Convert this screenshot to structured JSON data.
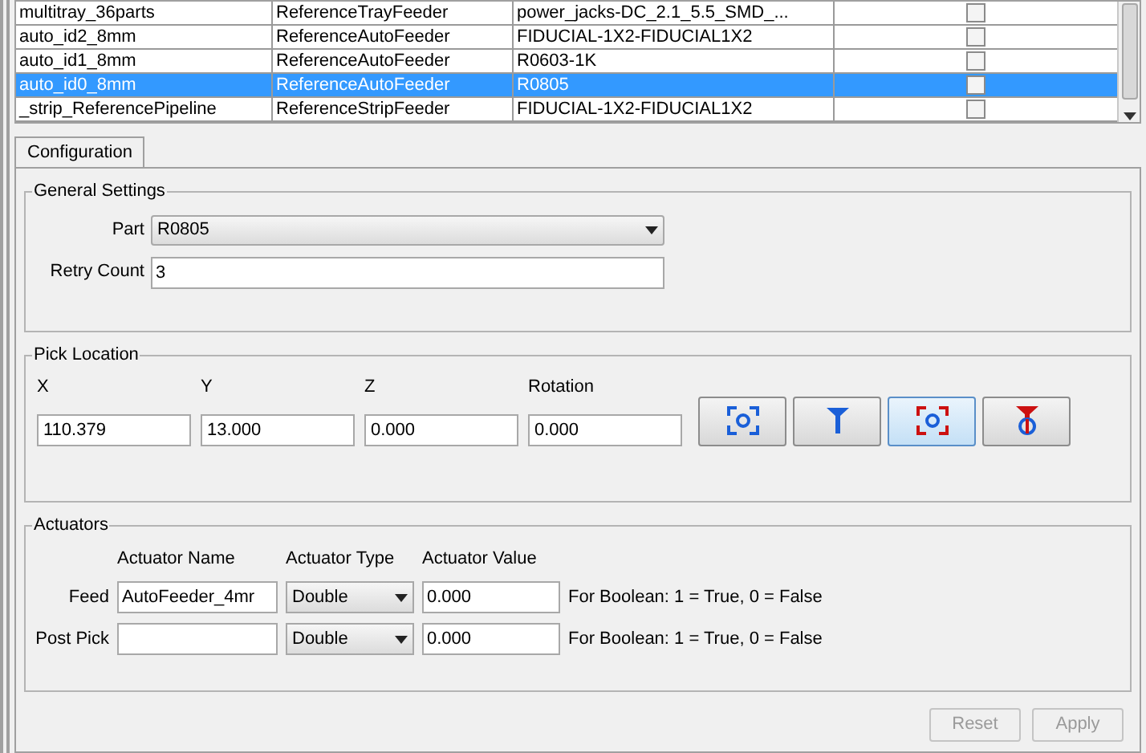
{
  "table": {
    "rows": [
      {
        "cells": [
          "multitray_36parts",
          "ReferenceTrayFeeder",
          "power_jacks-DC_2.1_5.5_SMD_..."
        ],
        "checked": false,
        "selected": false
      },
      {
        "cells": [
          "auto_id2_8mm",
          "ReferenceAutoFeeder",
          "FIDUCIAL-1X2-FIDUCIAL1X2"
        ],
        "checked": false,
        "selected": false
      },
      {
        "cells": [
          "auto_id1_8mm",
          "ReferenceAutoFeeder",
          "R0603-1K"
        ],
        "checked": false,
        "selected": false
      },
      {
        "cells": [
          "auto_id0_8mm",
          "ReferenceAutoFeeder",
          "R0805"
        ],
        "checked": false,
        "selected": true
      },
      {
        "cells": [
          "_strip_ReferencePipeline",
          "ReferenceStripFeeder",
          "FIDUCIAL-1X2-FIDUCIAL1X2"
        ],
        "checked": false,
        "selected": false
      }
    ]
  },
  "tabs": [
    {
      "label": "Configuration",
      "selected": true
    }
  ],
  "general_settings": {
    "title": "General Settings",
    "part": {
      "label": "Part",
      "value": "R0805"
    },
    "retry_count": {
      "label": "Retry Count",
      "value": "3"
    }
  },
  "pick_location": {
    "title": "Pick Location",
    "fields": [
      {
        "label": "X",
        "value": "110.379"
      },
      {
        "label": "Y",
        "value": "13.000"
      },
      {
        "label": "Z",
        "value": "0.000"
      },
      {
        "label": "Rotation",
        "value": "0.000"
      }
    ],
    "tool_buttons": [
      {
        "kind": "camera-capture",
        "selected": false
      },
      {
        "kind": "nozzle-capture",
        "selected": false
      },
      {
        "kind": "camera-position",
        "selected": true
      },
      {
        "kind": "nozzle-position",
        "selected": false
      }
    ]
  },
  "actuators": {
    "title": "Actuators",
    "columns": [
      "Actuator Name",
      "Actuator Type",
      "Actuator Value"
    ],
    "rows": [
      {
        "label": "Feed",
        "name": "AutoFeeder_4mr",
        "type": "Double",
        "value": "0.000",
        "hint": "For Boolean: 1 = True, 0 = False"
      },
      {
        "label": "Post Pick",
        "type": "Double",
        "value": "0.000",
        "hint": "For Boolean: 1 = True, 0 = False"
      }
    ]
  },
  "buttons": [
    {
      "label": "Reset",
      "disabled": true
    },
    {
      "label": "Apply",
      "disabled": true
    }
  ]
}
